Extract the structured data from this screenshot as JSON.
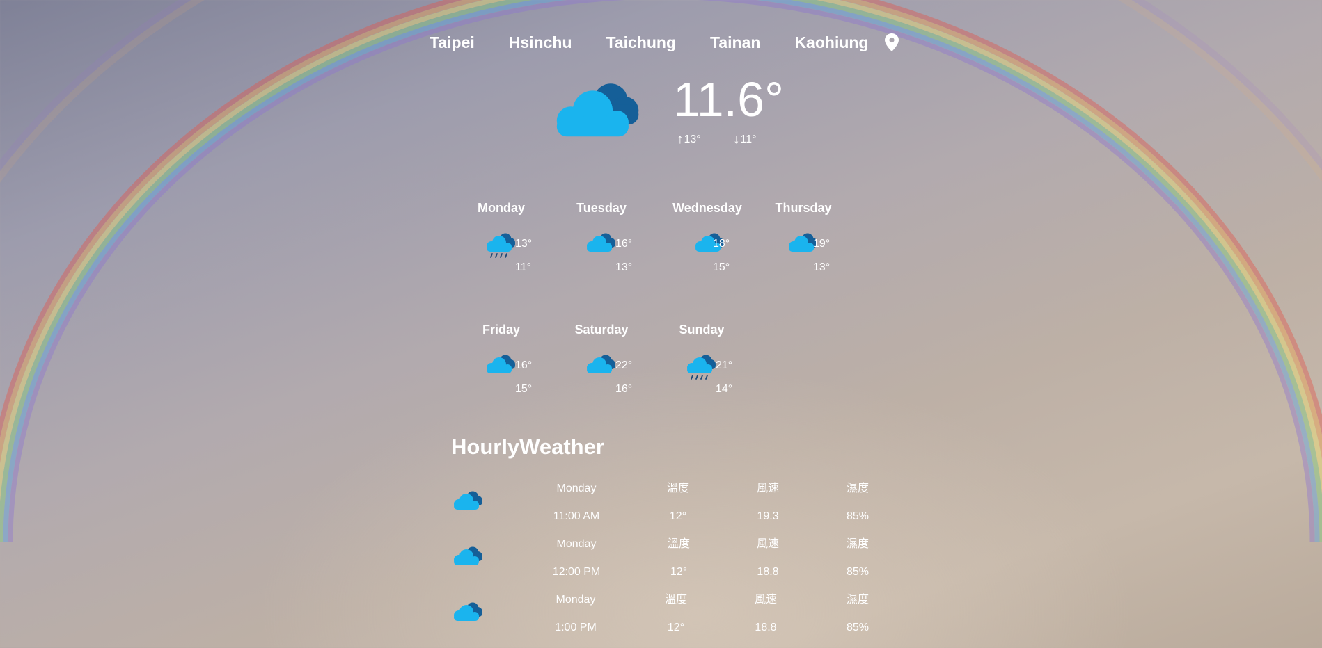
{
  "nav": {
    "cities": [
      "Taipei",
      "Hsinchu",
      "Taichung",
      "Tainan",
      "Kaohiung"
    ],
    "location_icon": "map-pin-icon"
  },
  "current": {
    "icon": "cloudy-icon",
    "temp": "11.6°",
    "high": "13°",
    "low": "11°"
  },
  "daily": [
    {
      "day": "Monday",
      "icon": "rain-cloud-icon",
      "high": "13°",
      "low": "11°"
    },
    {
      "day": "Tuesday",
      "icon": "cloudy-icon",
      "high": "16°",
      "low": "13°"
    },
    {
      "day": "Wednesday",
      "icon": "cloudy-icon",
      "high": "18°",
      "low": "15°"
    },
    {
      "day": "Thursday",
      "icon": "cloudy-icon",
      "high": "19°",
      "low": "13°"
    },
    {
      "day": "Friday",
      "icon": "cloudy-icon",
      "high": "16°",
      "low": "15°"
    },
    {
      "day": "Saturday",
      "icon": "cloudy-icon",
      "high": "22°",
      "low": "16°"
    },
    {
      "day": "Sunday",
      "icon": "rain-cloud-icon",
      "high": "21°",
      "low": "14°"
    }
  ],
  "hourly": {
    "title": "HourlyWeather",
    "rows": [
      {
        "icon": "cloudy-icon",
        "day": "Monday",
        "time": "11:00 AM",
        "temp_label": "溫度",
        "temp": "12°",
        "wind_label": "風速",
        "wind": "19.3",
        "humidity_label": "濕度",
        "humidity": "85%"
      },
      {
        "icon": "cloudy-icon",
        "day": "Monday",
        "time": "12:00 PM",
        "temp_label": "溫度",
        "temp": "12°",
        "wind_label": "風速",
        "wind": "18.8",
        "humidity_label": "濕度",
        "humidity": "85%"
      },
      {
        "icon": "cloudy-icon",
        "day": "Monday",
        "time": "1:00 PM",
        "temp_label": "溫度",
        "temp": "12°",
        "wind_label": "風速",
        "wind": "18.8",
        "humidity_label": "濕度",
        "humidity": "85%"
      }
    ]
  },
  "colors": {
    "cloud_front": "#1ab4ee",
    "cloud_back": "#155f98",
    "rain": "#1e4a78"
  }
}
